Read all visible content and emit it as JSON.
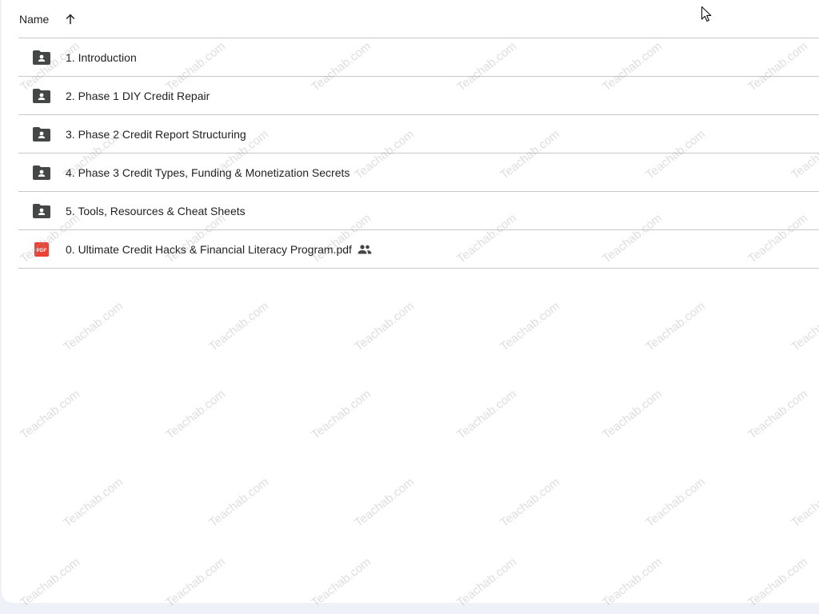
{
  "header": {
    "name_label": "Name",
    "sort_icon": "arrow-up-icon"
  },
  "items": [
    {
      "label": "1. Introduction",
      "icon": "shared-folder-icon",
      "shared": false
    },
    {
      "label": "2. Phase 1 DIY Credit Repair",
      "icon": "shared-folder-icon",
      "shared": false
    },
    {
      "label": "3. Phase 2 Credit Report Structuring",
      "icon": "shared-folder-icon",
      "shared": false
    },
    {
      "label": "4. Phase 3 Credit Types, Funding & Monetization Secrets",
      "icon": "shared-folder-icon",
      "shared": false
    },
    {
      "label": "5. Tools, Resources & Cheat Sheets",
      "icon": "shared-folder-icon",
      "shared": false
    },
    {
      "label": "0. Ultimate Credit Hacks & Financial Literacy Program.pdf",
      "icon": "pdf-icon",
      "pdf_badge": "PDF",
      "shared": true,
      "shared_icon": "people-icon"
    }
  ],
  "watermark": "Teachab.com",
  "colors": {
    "folder": "#444746",
    "pdf": "#ea4335",
    "divider": "#c7c7c7",
    "text": "#1f1f1f"
  }
}
